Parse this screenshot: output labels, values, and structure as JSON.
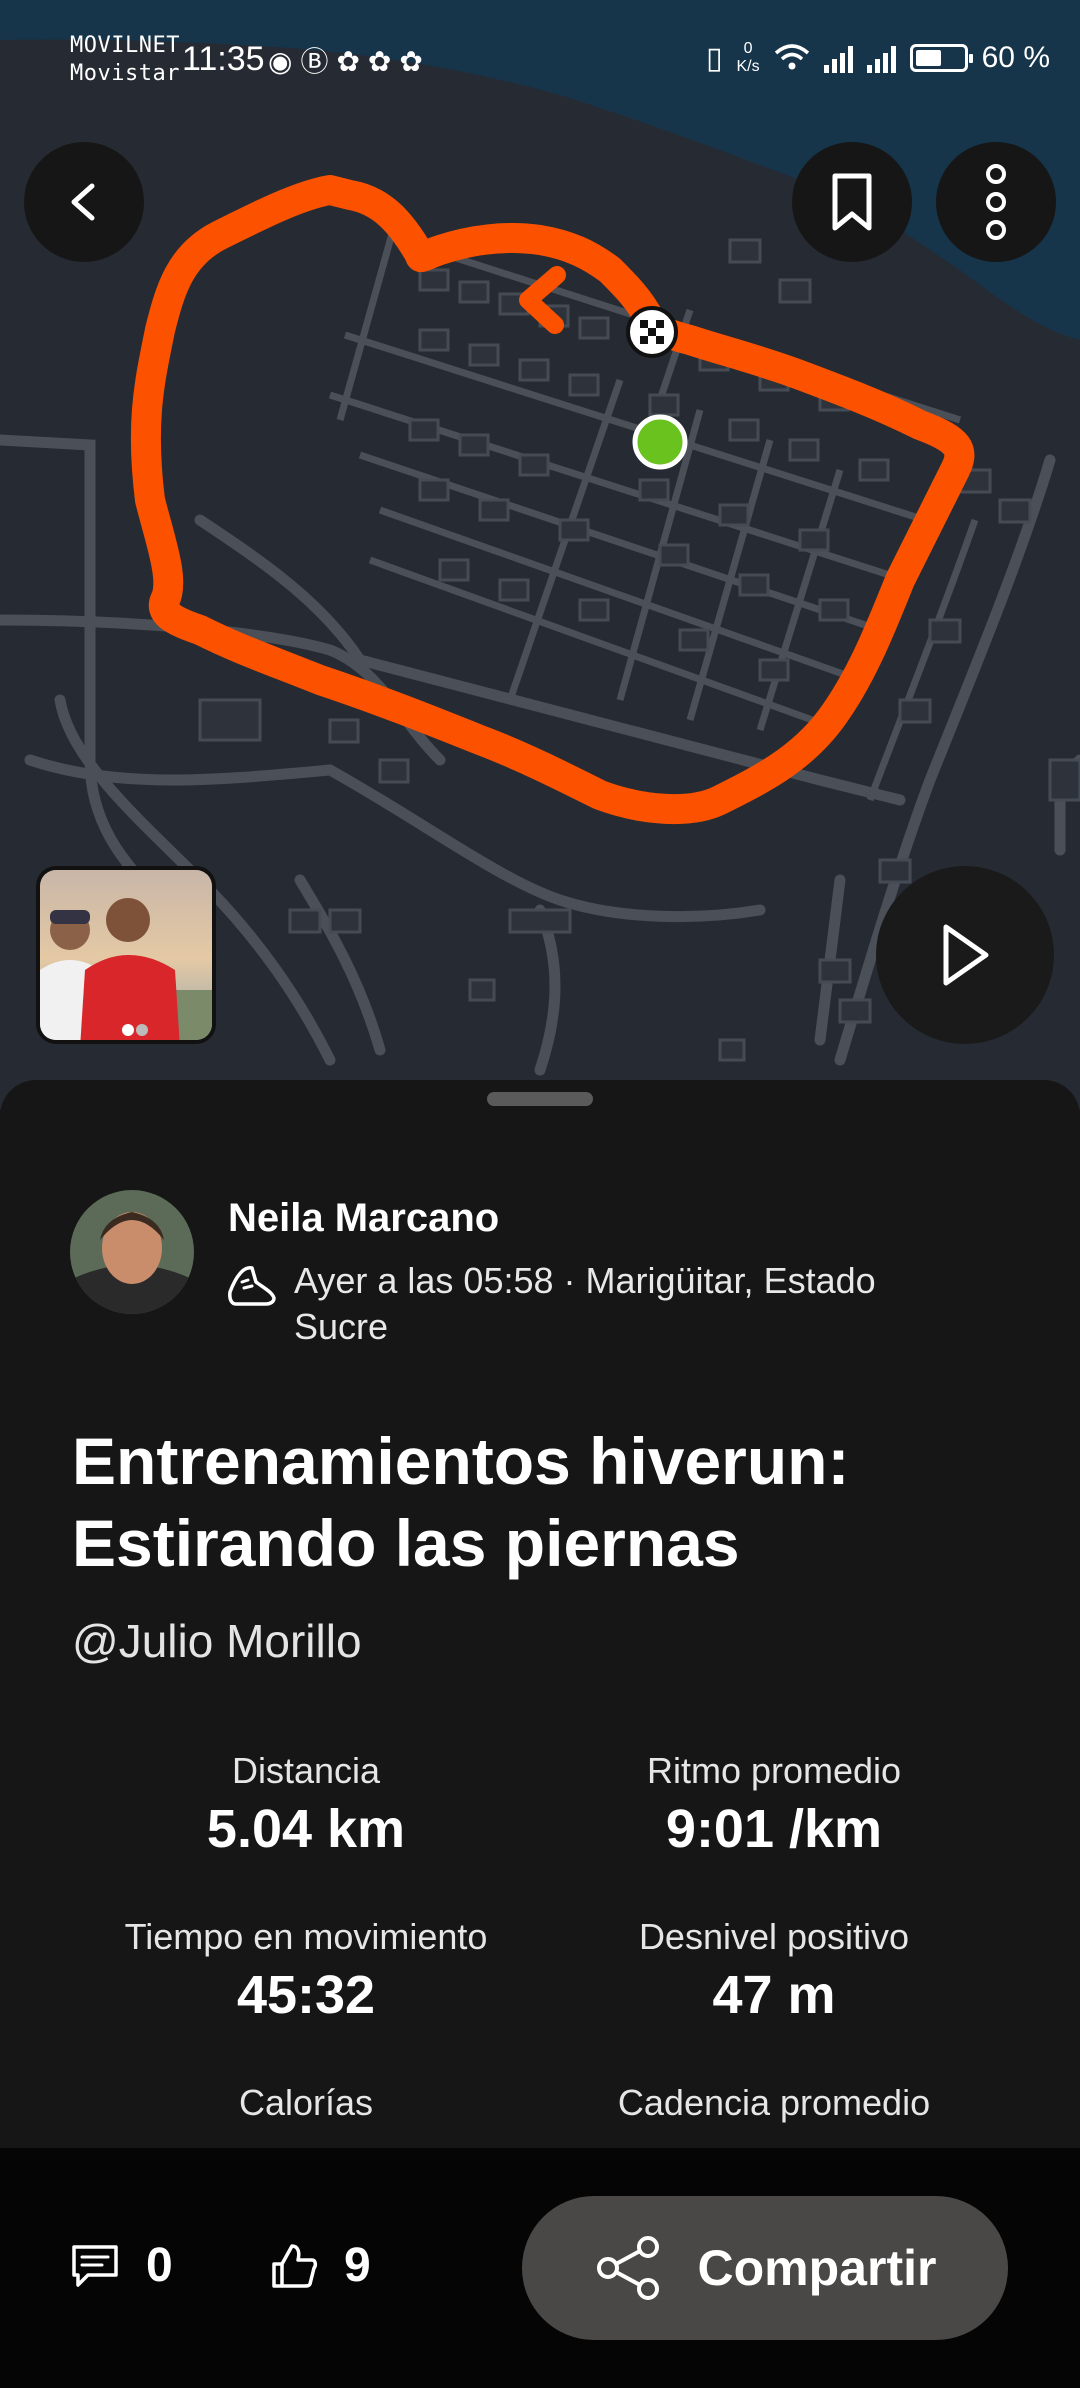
{
  "status_bar": {
    "carrier_1": "MOVILNET",
    "carrier_2": "Movistar",
    "time": "11:35",
    "net_speed_value": "0",
    "net_speed_unit": "K/s",
    "battery": "60 %",
    "battery_level_percent": 60,
    "left_icons": [
      "eye-icon",
      "b-icon",
      "notification-icon",
      "notification-icon",
      "notification-icon"
    ],
    "right_icons": [
      "vibrate-icon",
      "wifi-icon",
      "signal-icon",
      "signal-icon",
      "battery-icon"
    ]
  },
  "map": {
    "route_color": "#fc5200",
    "start_marker_color": "#69c21e",
    "buttons": [
      "back-icon",
      "bookmark-icon",
      "more-icon",
      "play-icon"
    ]
  },
  "activity": {
    "athlete_name": "Neila Marcano",
    "meta_line": "Ayer a las 05:58 · Marigüitar, Estado Sucre",
    "title": "Entrenamientos hiverun: Estirando las piernas",
    "mention": "@Julio Morillo",
    "stats": [
      {
        "label": "Distancia",
        "value": "5.04 km"
      },
      {
        "label": "Ritmo promedio",
        "value": "9:01 /km"
      },
      {
        "label": "Tiempo en movimiento",
        "value": "45:32"
      },
      {
        "label": "Desnivel positivo",
        "value": "47 m"
      },
      {
        "label": "Calorías",
        "value": ""
      },
      {
        "label": "Cadencia promedio",
        "value": ""
      }
    ]
  },
  "bottom_bar": {
    "comments_count": "0",
    "kudos_count": "9",
    "share_label": "Compartir"
  }
}
